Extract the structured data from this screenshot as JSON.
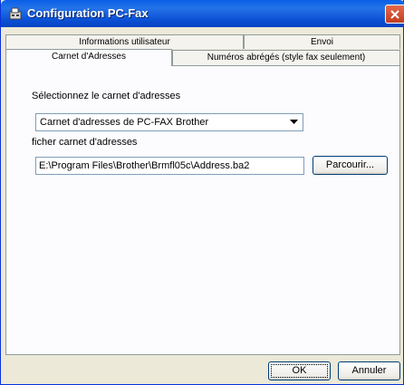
{
  "window": {
    "title": "Configuration PC-Fax"
  },
  "tabs": {
    "row_back": [
      "Informations utilisateur",
      "Envoi"
    ],
    "row_front": [
      "Carnet d'Adresses",
      "Numéros abrégés (style fax seulement)"
    ]
  },
  "addressbook": {
    "select_label": "Sélectionnez le carnet d'adresses",
    "select_value": "Carnet d'adresses de PC-FAX Brother",
    "file_label": "ficher carnet d'adresses",
    "file_value": "E:\\Program Files\\Brother\\Brmfl05c\\Address.ba2",
    "browse_label": "Parcourir..."
  },
  "footer": {
    "ok_label": "OK",
    "cancel_label": "Annuler"
  },
  "icons": {
    "app": "fax-icon",
    "close": "close-icon",
    "dropdown": "chevron-down-icon"
  },
  "colors": {
    "titlebar": "#0a5fe8",
    "dialog_bg": "#ece9d8",
    "close_red": "#d9542f"
  }
}
